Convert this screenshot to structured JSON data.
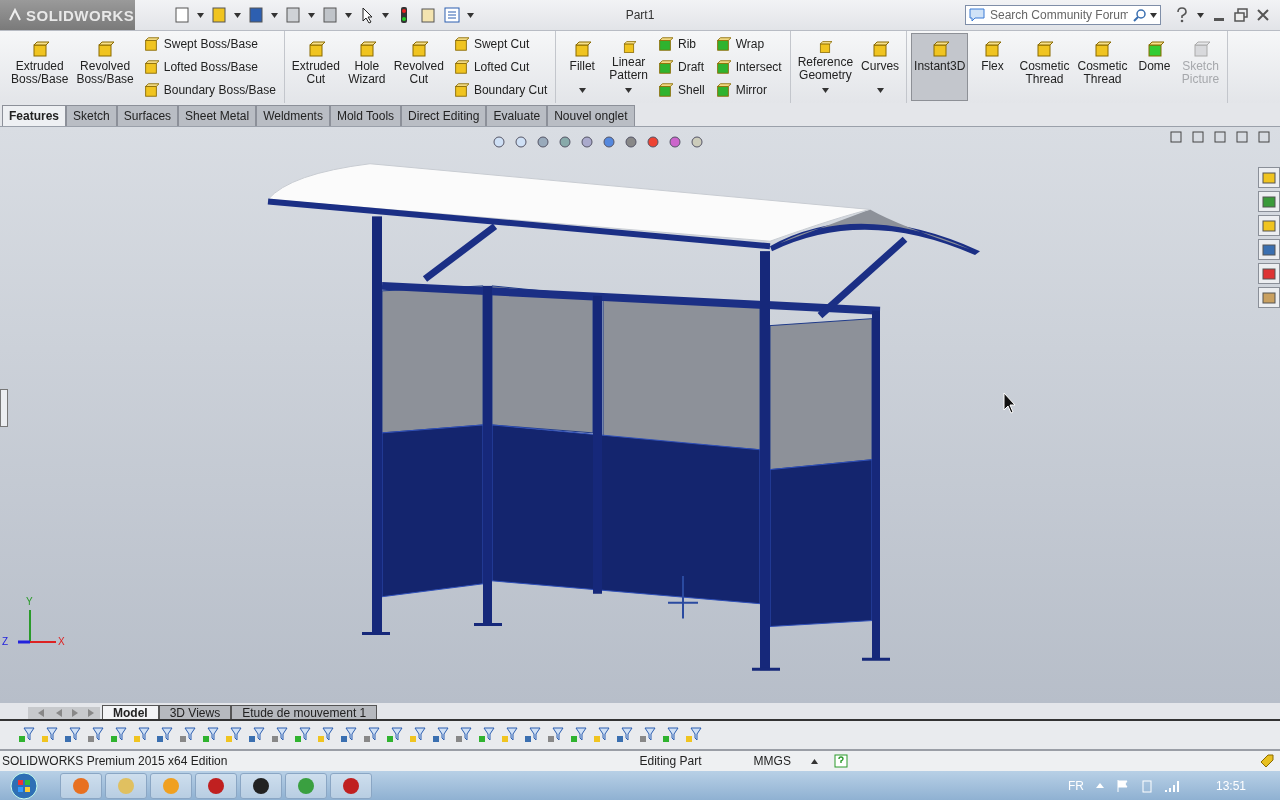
{
  "title_bar": {
    "logo": "SOLIDWORKS",
    "title": "Part1",
    "search": {
      "placeholder": "Search Community Forum"
    }
  },
  "ribbon": {
    "groups": [
      [
        {
          "kind": "large",
          "label": "Extruded\nBoss/Base",
          "on": false,
          "disabled": false,
          "dropdown": false
        },
        {
          "kind": "large",
          "label": "Revolved\nBoss/Base",
          "on": false,
          "disabled": false,
          "dropdown": false
        },
        {
          "kind": "stack",
          "items": [
            "Swept Boss/Base",
            "Lofted Boss/Base",
            "Boundary Boss/Base"
          ]
        }
      ],
      [
        {
          "kind": "large",
          "label": "Extruded\nCut",
          "on": false,
          "disabled": false,
          "dropdown": false
        },
        {
          "kind": "large",
          "label": "Hole\nWizard",
          "on": false,
          "disabled": false,
          "dropdown": false
        },
        {
          "kind": "large",
          "label": "Revolved\nCut",
          "on": false,
          "disabled": false,
          "dropdown": false
        },
        {
          "kind": "stack",
          "items": [
            "Swept Cut",
            "Lofted Cut",
            "Boundary Cut"
          ]
        }
      ],
      [
        {
          "kind": "large",
          "label": "Fillet",
          "on": false,
          "disabled": false,
          "dropdown": true
        },
        {
          "kind": "large",
          "label": "Linear\nPattern",
          "on": false,
          "disabled": false,
          "dropdown": true
        },
        {
          "kind": "stack",
          "items": [
            "Rib",
            "Draft",
            "Shell"
          ]
        },
        {
          "kind": "stack",
          "items": [
            "Wrap",
            "Intersect",
            "Mirror"
          ]
        }
      ],
      [
        {
          "kind": "large",
          "label": "Reference\nGeometry",
          "on": false,
          "disabled": false,
          "dropdown": true
        },
        {
          "kind": "large",
          "label": "Curves",
          "on": false,
          "disabled": false,
          "dropdown": true
        }
      ],
      [
        {
          "kind": "large",
          "label": "Instant3D",
          "on": true,
          "disabled": false,
          "dropdown": false
        },
        {
          "kind": "large",
          "label": "Flex",
          "on": false,
          "disabled": false,
          "dropdown": false
        },
        {
          "kind": "large",
          "label": "Cosmetic\nThread",
          "on": false,
          "disabled": false,
          "dropdown": false
        },
        {
          "kind": "large",
          "label": "Cosmetic\nThread",
          "on": false,
          "disabled": false,
          "dropdown": false
        },
        {
          "kind": "large",
          "label": "Dome",
          "on": false,
          "disabled": false,
          "dropdown": false
        },
        {
          "kind": "large",
          "label": "Sketch\nPicture",
          "on": false,
          "disabled": true,
          "dropdown": false
        }
      ]
    ]
  },
  "tabs": [
    {
      "label": "Features",
      "selected": true
    },
    {
      "label": "Sketch",
      "selected": false
    },
    {
      "label": "Surfaces",
      "selected": false
    },
    {
      "label": "Sheet Metal",
      "selected": false
    },
    {
      "label": "Weldments",
      "selected": false
    },
    {
      "label": "Mold Tools",
      "selected": false
    },
    {
      "label": "Direct Editing",
      "selected": false
    },
    {
      "label": "Evaluate",
      "selected": false
    },
    {
      "label": "Nouvel onglet",
      "selected": false
    }
  ],
  "viewport": {
    "triad": {
      "x": "X",
      "y": "Y",
      "z": "Z"
    }
  },
  "bottom_tabs": [
    {
      "label": "Model",
      "selected": true
    },
    {
      "label": "3D Views",
      "selected": false
    },
    {
      "label": "Etude de mouvement 1",
      "selected": false
    }
  ],
  "status_bar": {
    "product": "SOLIDWORKS Premium 2015 x64 Edition",
    "mode": "Editing Part",
    "units": "MMGS"
  },
  "taskbar": {
    "language": "FR",
    "clock": "13:51"
  }
}
